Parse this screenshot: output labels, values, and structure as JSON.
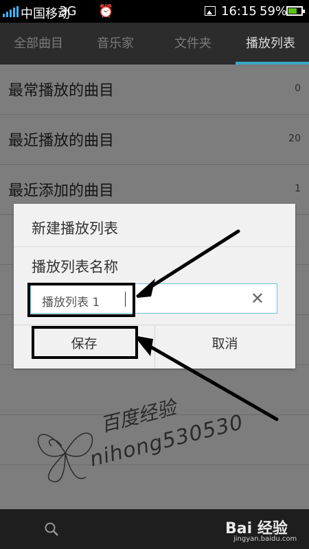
{
  "status": {
    "carrier": "中国移动",
    "network": "3G",
    "time": "16:15",
    "battery": "59%",
    "battery_level": 0.59,
    "icons": [
      "signal-icon",
      "alarm-icon",
      "image-icon",
      "battery-icon"
    ]
  },
  "tabs": [
    {
      "label": "全部曲目"
    },
    {
      "label": "音乐家"
    },
    {
      "label": "文件夹"
    },
    {
      "label": "播放列表",
      "active": true
    }
  ],
  "playlists": [
    {
      "title": "最常播放的曲目",
      "count": "0"
    },
    {
      "title": "最近播放的曲目",
      "count": "20"
    },
    {
      "title": "最近添加的曲目",
      "count": "1"
    }
  ],
  "dialog": {
    "title": "新建播放列表",
    "label": "播放列表名称",
    "input_value": "播放列表 1",
    "save": "保存",
    "cancel": "取消"
  },
  "watermark": {
    "line1": "百度经验",
    "line2": "nihong530530",
    "brand": "Bai 经验",
    "site": "jingyan.baidu.com"
  },
  "colors": {
    "accent": "#3aa6c8",
    "signal": "#3db6ff",
    "battery": "#5ec21b"
  }
}
